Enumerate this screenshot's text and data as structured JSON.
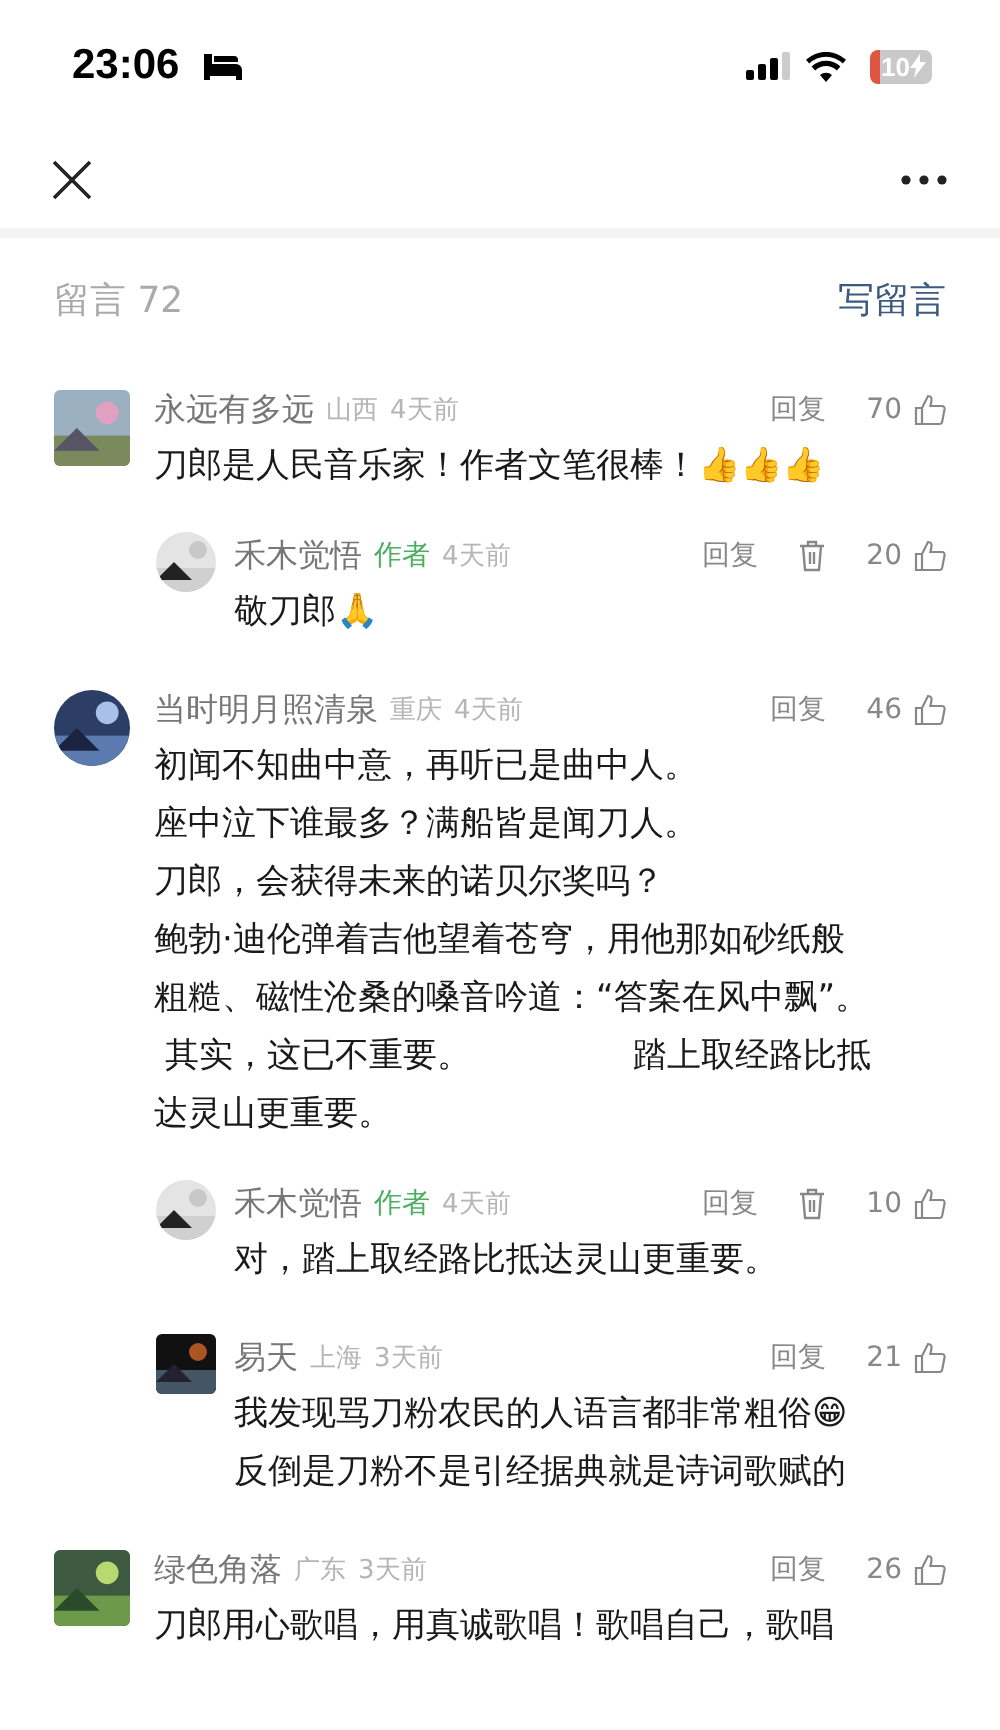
{
  "status_bar": {
    "time": "23:06",
    "battery": "10"
  },
  "header": {
    "title": "留言 72",
    "write_label": "写留言"
  },
  "comments": [
    {
      "name": "永远有多远",
      "region": "山西",
      "time": "4天前",
      "author": false,
      "reply_label": "回复",
      "deletable": false,
      "likes": "70",
      "kind": "square",
      "paragraphs": [
        "刀郎是人民音乐家！作者文笔很棒！👍👍👍"
      ],
      "children": [
        {
          "name": "禾木觉悟",
          "badge": "作者",
          "time": "4天前",
          "author": true,
          "reply_label": "回复",
          "deletable": true,
          "likes": "20",
          "kind": "round",
          "paragraphs": [
            "敬刀郎🙏"
          ]
        }
      ]
    },
    {
      "name": "当时明月照清泉",
      "region": "重庆",
      "time": "4天前",
      "author": false,
      "reply_label": "回复",
      "deletable": false,
      "likes": "46",
      "kind": "round",
      "paragraphs": [
        "初闻不知曲中意，再听已是曲中人。",
        "座中泣下谁最多？满船皆是闻刀人。",
        "刀郎，会获得未来的诺贝尔奖吗？",
        "鲍勃·迪伦弹着吉他望着苍穹，用他那如砂纸般粗糙、磁性沧桑的嗓音吟道：“答案在风中飘”。",
        " 其实，这已不重要。               踏上取经路比抵达灵山更重要。"
      ],
      "children": [
        {
          "name": "禾木觉悟",
          "badge": "作者",
          "time": "4天前",
          "author": true,
          "reply_label": "回复",
          "deletable": true,
          "likes": "10",
          "kind": "round",
          "paragraphs": [
            "对，踏上取经路比抵达灵山更重要。"
          ]
        },
        {
          "name": "易天",
          "region": "上海",
          "time": "3天前",
          "author": false,
          "reply_label": "回复",
          "deletable": false,
          "likes": "21",
          "kind": "square",
          "paragraphs": [
            "我发现骂刀粉农民的人语言都非常粗俗😁",
            "反倒是刀粉不是引经据典就是诗词歌赋的"
          ]
        }
      ]
    },
    {
      "name": "绿色角落",
      "region": "广东",
      "time": "3天前",
      "author": false,
      "reply_label": "回复",
      "deletable": false,
      "likes": "26",
      "kind": "square",
      "paragraphs": [
        "刀郎用心歌唱，用真诚歌唱！歌唱自己，歌唱"
      ]
    }
  ]
}
